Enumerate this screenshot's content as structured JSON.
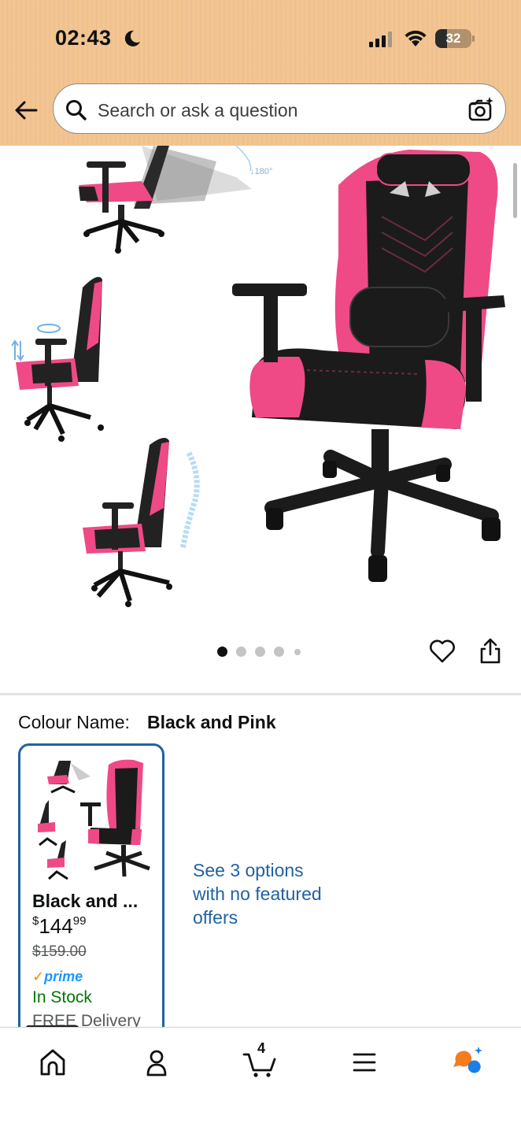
{
  "status_bar": {
    "time": "02:43",
    "battery": "32"
  },
  "header": {
    "search_placeholder": "Search or ask a question"
  },
  "hero": {
    "image_count": 5,
    "active_index": 0,
    "rotation_label": "180°"
  },
  "colour": {
    "label": "Colour Name:",
    "value": "Black and Pink"
  },
  "variant": {
    "title": "Black and ...",
    "price_currency": "$",
    "price_whole": "144",
    "price_fraction": "99",
    "was_price": "$159.00",
    "prime_label": "prime",
    "stock": "In Stock",
    "delivery": "FREE Delivery"
  },
  "see_options": "See 3 options with no featured offers",
  "nav": {
    "cart_count": "4"
  },
  "colors": {
    "accent_blue": "#2162a1",
    "prime_blue": "#1a98ff",
    "stock_green": "#007600",
    "chair_pink": "#ef4a86"
  }
}
